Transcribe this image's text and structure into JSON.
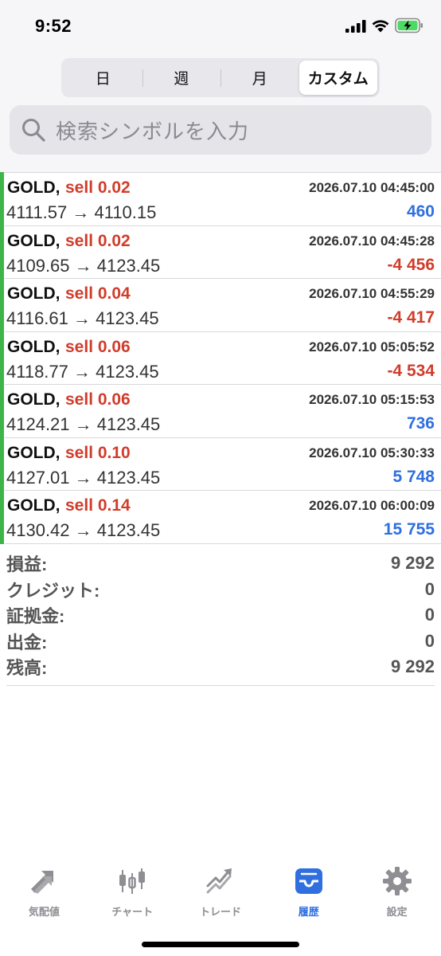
{
  "status_bar": {
    "time": "9:52"
  },
  "segments": [
    {
      "label": "日",
      "active": false
    },
    {
      "label": "週",
      "active": false
    },
    {
      "label": "月",
      "active": false
    },
    {
      "label": "カスタム",
      "active": true
    }
  ],
  "search": {
    "placeholder": "検索シンボルを入力"
  },
  "trades": [
    {
      "symbol": "GOLD,",
      "side": "sell 0.02",
      "time": "2026.07.10 04:45:00",
      "prices": "4111.57 → 4110.15",
      "profit": "460",
      "profit_sign": "positive"
    },
    {
      "symbol": "GOLD,",
      "side": "sell 0.02",
      "time": "2026.07.10 04:45:28",
      "prices": "4109.65 → 4123.45",
      "profit": "-4 456",
      "profit_sign": "negative"
    },
    {
      "symbol": "GOLD,",
      "side": "sell 0.04",
      "time": "2026.07.10 04:55:29",
      "prices": "4116.61 → 4123.45",
      "profit": "-4 417",
      "profit_sign": "negative"
    },
    {
      "symbol": "GOLD,",
      "side": "sell 0.06",
      "time": "2026.07.10 05:05:52",
      "prices": "4118.77 → 4123.45",
      "profit": "-4 534",
      "profit_sign": "negative"
    },
    {
      "symbol": "GOLD,",
      "side": "sell 0.06",
      "time": "2026.07.10 05:15:53",
      "prices": "4124.21 → 4123.45",
      "profit": "736",
      "profit_sign": "positive"
    },
    {
      "symbol": "GOLD,",
      "side": "sell 0.10",
      "time": "2026.07.10 05:30:33",
      "prices": "4127.01 → 4123.45",
      "profit": "5 748",
      "profit_sign": "positive"
    },
    {
      "symbol": "GOLD,",
      "side": "sell 0.14",
      "time": "2026.07.10 06:00:09",
      "prices": "4130.42 → 4123.45",
      "profit": "15 755",
      "profit_sign": "positive"
    }
  ],
  "summary": [
    {
      "label": "損益:",
      "value": "9 292"
    },
    {
      "label": "クレジット:",
      "value": "0"
    },
    {
      "label": "証拠金:",
      "value": "0"
    },
    {
      "label": "出金:",
      "value": "0"
    },
    {
      "label": "残高:",
      "value": "9 292"
    }
  ],
  "tabs": [
    {
      "label": "気配値",
      "icon": "quotes-arrows-icon",
      "active": false
    },
    {
      "label": "チャート",
      "icon": "candlestick-chart-icon",
      "active": false
    },
    {
      "label": "トレード",
      "icon": "trade-trend-icon",
      "active": false
    },
    {
      "label": "履歴",
      "icon": "history-tray-icon",
      "active": true
    },
    {
      "label": "設定",
      "icon": "gear-icon",
      "active": false
    }
  ],
  "colors": {
    "accent_blue": "#2f6fe0",
    "loss_red": "#d13c2b",
    "row_marker_green": "#3fb549",
    "inactive_gray": "#8e8e93"
  }
}
